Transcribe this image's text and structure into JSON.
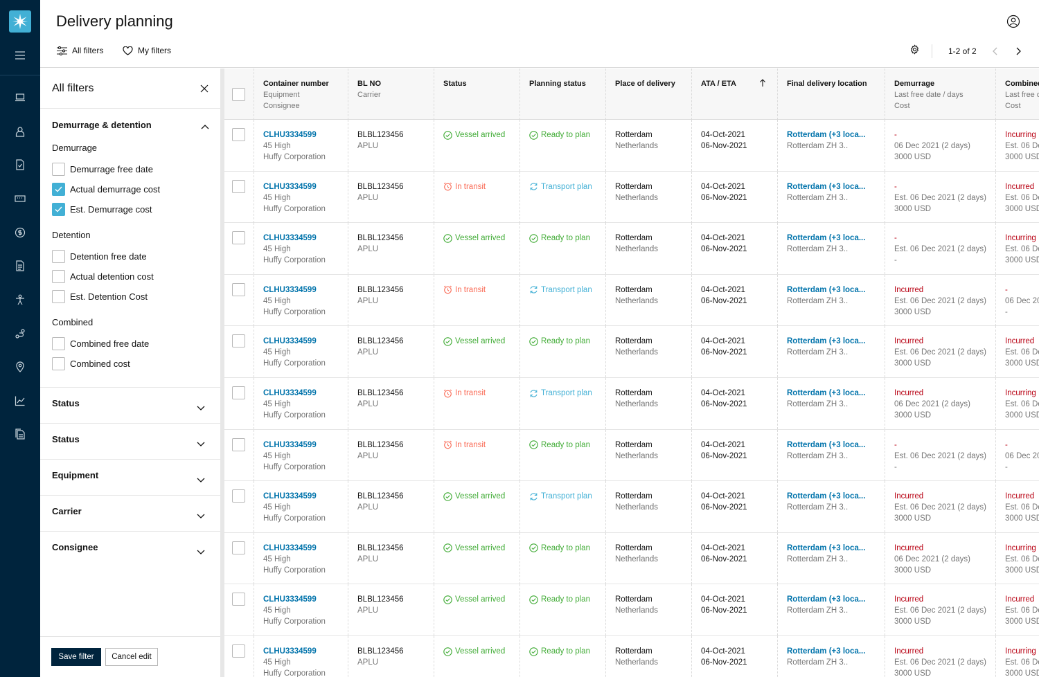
{
  "header": {
    "title": "Delivery planning",
    "all_filters": "All filters",
    "my_filters": "My filters",
    "pagination": "1-2 of 2"
  },
  "panel": {
    "title": "All filters",
    "sections": {
      "dd": "Demurrage & detention",
      "status1": "Status",
      "status2": "Status",
      "equipment": "Equipment",
      "carrier": "Carrier",
      "consignee": "Consignee"
    },
    "groups": {
      "demurrage": "Demurrage",
      "detention": "Detention",
      "combined": "Combined"
    },
    "options": [
      {
        "label": "Demurrage free date",
        "checked": false
      },
      {
        "label": "Actual demurrage cost",
        "checked": true
      },
      {
        "label": "Est. Demurrage cost",
        "checked": true
      },
      {
        "label": "Detention free date",
        "checked": false
      },
      {
        "label": "Actual detention cost",
        "checked": false
      },
      {
        "label": "Est. Detention Cost",
        "checked": false
      },
      {
        "label": "Combined free date",
        "checked": false
      },
      {
        "label": "Combined cost",
        "checked": false
      }
    ],
    "save": "Save filter",
    "cancel": "Cancel edit"
  },
  "columns": [
    {
      "l1": "Container number",
      "l2": "Equipment",
      "l3": "Consignee"
    },
    {
      "l1": "BL NO",
      "l2": "Carrier",
      "l3": ""
    },
    {
      "l1": "Status",
      "l2": "",
      "l3": ""
    },
    {
      "l1": "Planning status",
      "l2": "",
      "l3": ""
    },
    {
      "l1": "Place of delivery",
      "l2": "",
      "l3": ""
    },
    {
      "l1": "ATA / ETA",
      "l2": "",
      "l3": ""
    },
    {
      "l1": "Final delivery location",
      "l2": "",
      "l3": ""
    },
    {
      "l1": "Demurrage",
      "l2": "Last free date / days",
      "l3": "Cost"
    },
    {
      "l1": "Combined",
      "l2": "Last free d",
      "l3": "Cost"
    }
  ],
  "rows": [
    {
      "container": "CLHU3334599",
      "equipment": "45 High",
      "consignee": "Huffy Corporation",
      "bl": "BLBL123456",
      "carrier": "APLU",
      "status": "Vessel arrived",
      "status_type": "arrived",
      "planning": "Ready to plan",
      "planning_type": "ready",
      "place": "Rotterdam",
      "country": "Netherlands",
      "ata": "04-Oct-2021",
      "eta": "06-Nov-2021",
      "fdl": "Rotterdam (+3 loca...",
      "fdl_sub": "Rotterdam ZH 3..",
      "dem1": "-",
      "dem2": "06 Dec 2021 (2 days)",
      "dem3": "3000 USD",
      "comb1": "Incurring",
      "comb2": "Est. 06 De",
      "comb3": "3000 USD"
    },
    {
      "container": "CLHU3334599",
      "equipment": "45 High",
      "consignee": "Huffy Corporation",
      "bl": "BLBL123456",
      "carrier": "APLU",
      "status": "In transit",
      "status_type": "transit",
      "planning": "Transport plan",
      "planning_type": "transport",
      "place": "Rotterdam",
      "country": "Netherlands",
      "ata": "04-Oct-2021",
      "eta": "06-Nov-2021",
      "fdl": "Rotterdam (+3 loca...",
      "fdl_sub": "Rotterdam ZH 3..",
      "dem1": "-",
      "dem2": "Est. 06 Dec 2021 (2 days)",
      "dem3": "3000 USD",
      "comb1": "Incurred",
      "comb2": "Est. 06 De",
      "comb3": "3000 USD"
    },
    {
      "container": "CLHU3334599",
      "equipment": "45 High",
      "consignee": "Huffy Corporation",
      "bl": "BLBL123456",
      "carrier": "APLU",
      "status": "Vessel arrived",
      "status_type": "arrived",
      "planning": "Ready to plan",
      "planning_type": "ready",
      "place": "Rotterdam",
      "country": "Netherlands",
      "ata": "04-Oct-2021",
      "eta": "06-Nov-2021",
      "fdl": "Rotterdam (+3 loca...",
      "fdl_sub": "Rotterdam ZH 3..",
      "dem1": "-",
      "dem2": "Est. 06 Dec 2021 (2 days)",
      "dem3": "-",
      "comb1": "Incurring",
      "comb2": "Est. 06 De",
      "comb3": "3000 USD"
    },
    {
      "container": "CLHU3334599",
      "equipment": "45 High",
      "consignee": "Huffy Corporation",
      "bl": "BLBL123456",
      "carrier": "APLU",
      "status": "In transit",
      "status_type": "transit",
      "planning": "Transport plan",
      "planning_type": "transport",
      "place": "Rotterdam",
      "country": "Netherlands",
      "ata": "04-Oct-2021",
      "eta": "06-Nov-2021",
      "fdl": "Rotterdam (+3 loca...",
      "fdl_sub": "Rotterdam ZH 3..",
      "dem1": "Incurred",
      "dem2": "Est. 06 Dec 2021 (2 days)",
      "dem3": "3000 USD",
      "comb1": "-",
      "comb2": "06 Dec 20",
      "comb3": "-"
    },
    {
      "container": "CLHU3334599",
      "equipment": "45 High",
      "consignee": "Huffy Corporation",
      "bl": "BLBL123456",
      "carrier": "APLU",
      "status": "Vessel arrived",
      "status_type": "arrived",
      "planning": "Ready to plan",
      "planning_type": "ready",
      "place": "Rotterdam",
      "country": "Netherlands",
      "ata": "04-Oct-2021",
      "eta": "06-Nov-2021",
      "fdl": "Rotterdam (+3 loca...",
      "fdl_sub": "Rotterdam ZH 3..",
      "dem1": "Incurred",
      "dem2": "Est. 06 Dec 2021 (2 days)",
      "dem3": "3000 USD",
      "comb1": "Incurred",
      "comb2": "Est. 06 De",
      "comb3": "3000 USD"
    },
    {
      "container": "CLHU3334599",
      "equipment": "45 High",
      "consignee": "Huffy Corporation",
      "bl": "BLBL123456",
      "carrier": "APLU",
      "status": "In transit",
      "status_type": "transit",
      "planning": "Transport plan",
      "planning_type": "transport",
      "place": "Rotterdam",
      "country": "Netherlands",
      "ata": "04-Oct-2021",
      "eta": "06-Nov-2021",
      "fdl": "Rotterdam (+3 loca...",
      "fdl_sub": "Rotterdam ZH 3..",
      "dem1": "Incurred",
      "dem2": "06 Dec 2021 (2 days)",
      "dem3": "3000 USD",
      "comb1": "Incurring",
      "comb2": "Est. 06 De",
      "comb3": "3000 USD"
    },
    {
      "container": "CLHU3334599",
      "equipment": "45 High",
      "consignee": "Huffy Corporation",
      "bl": "BLBL123456",
      "carrier": "APLU",
      "status": "In transit",
      "status_type": "transit",
      "planning": "Ready to plan",
      "planning_type": "ready",
      "place": "Rotterdam",
      "country": "Netherlands",
      "ata": "04-Oct-2021",
      "eta": "06-Nov-2021",
      "fdl": "Rotterdam (+3 loca...",
      "fdl_sub": "Rotterdam ZH 3..",
      "dem1": "-",
      "dem2": "Est. 06 Dec 2021 (2 days)",
      "dem3": "-",
      "comb1": "-",
      "comb2": "06 Dec 20",
      "comb3": "-"
    },
    {
      "container": "CLHU3334599",
      "equipment": "45 High",
      "consignee": "Huffy Corporation",
      "bl": "BLBL123456",
      "carrier": "APLU",
      "status": "Vessel arrived",
      "status_type": "arrived",
      "planning": "Transport plan",
      "planning_type": "transport",
      "place": "Rotterdam",
      "country": "Netherlands",
      "ata": "04-Oct-2021",
      "eta": "06-Nov-2021",
      "fdl": "Rotterdam (+3 loca...",
      "fdl_sub": "Rotterdam ZH 3..",
      "dem1": "Incurred",
      "dem2": "Est. 06 Dec 2021 (2 days)",
      "dem3": "3000 USD",
      "comb1": "Incurred",
      "comb2": "Est. 06 De",
      "comb3": "3000 USD"
    },
    {
      "container": "CLHU3334599",
      "equipment": "45 High",
      "consignee": "Huffy Corporation",
      "bl": "BLBL123456",
      "carrier": "APLU",
      "status": "Vessel arrived",
      "status_type": "arrived",
      "planning": "Ready to plan",
      "planning_type": "ready",
      "place": "Rotterdam",
      "country": "Netherlands",
      "ata": "04-Oct-2021",
      "eta": "06-Nov-2021",
      "fdl": "Rotterdam (+3 loca...",
      "fdl_sub": "Rotterdam ZH 3..",
      "dem1": "Incurred",
      "dem2": "06 Dec 2021 (2 days)",
      "dem3": "3000 USD",
      "comb1": "Incurring",
      "comb2": "Est. 06 De",
      "comb3": "3000 USD"
    },
    {
      "container": "CLHU3334599",
      "equipment": "45 High",
      "consignee": "Huffy Corporation",
      "bl": "BLBL123456",
      "carrier": "APLU",
      "status": "Vessel arrived",
      "status_type": "arrived",
      "planning": "Ready to plan",
      "planning_type": "ready",
      "place": "Rotterdam",
      "country": "Netherlands",
      "ata": "04-Oct-2021",
      "eta": "06-Nov-2021",
      "fdl": "Rotterdam (+3 loca...",
      "fdl_sub": "Rotterdam ZH 3..",
      "dem1": "Incurred",
      "dem2": "Est. 06 Dec 2021 (2 days)",
      "dem3": "3000 USD",
      "comb1": "Incurred",
      "comb2": "Est. 06 De",
      "comb3": "3000 USD"
    },
    {
      "container": "CLHU3334599",
      "equipment": "45 High",
      "consignee": "Huffy Corporation",
      "bl": "BLBL123456",
      "carrier": "APLU",
      "status": "Vessel arrived",
      "status_type": "arrived",
      "planning": "Ready to plan",
      "planning_type": "ready",
      "place": "Rotterdam",
      "country": "Netherlands",
      "ata": "04-Oct-2021",
      "eta": "06-Nov-2021",
      "fdl": "Rotterdam (+3 loca...",
      "fdl_sub": "Rotterdam ZH 3..",
      "dem1": "Incurred",
      "dem2": "Est. 06 Dec 2021 (2 days)",
      "dem3": "3000 USD",
      "comb1": "Incurring",
      "comb2": "Est. 06 De",
      "comb3": "3000 USD"
    }
  ],
  "colors": {
    "nav_bg": "#00243d",
    "accent": "#42b0d5",
    "link": "#0073ab",
    "success": "#40ab35",
    "warning": "#fa6a55",
    "danger": "#b80012"
  },
  "icons": {
    "rail": [
      "menu-icon",
      "laptop-icon",
      "user-icon",
      "document-check-icon",
      "ticket-icon",
      "dollar-icon",
      "invoice-icon",
      "person-icon",
      "route-icon",
      "pin-icon",
      "chart-icon",
      "documents-icon"
    ]
  }
}
